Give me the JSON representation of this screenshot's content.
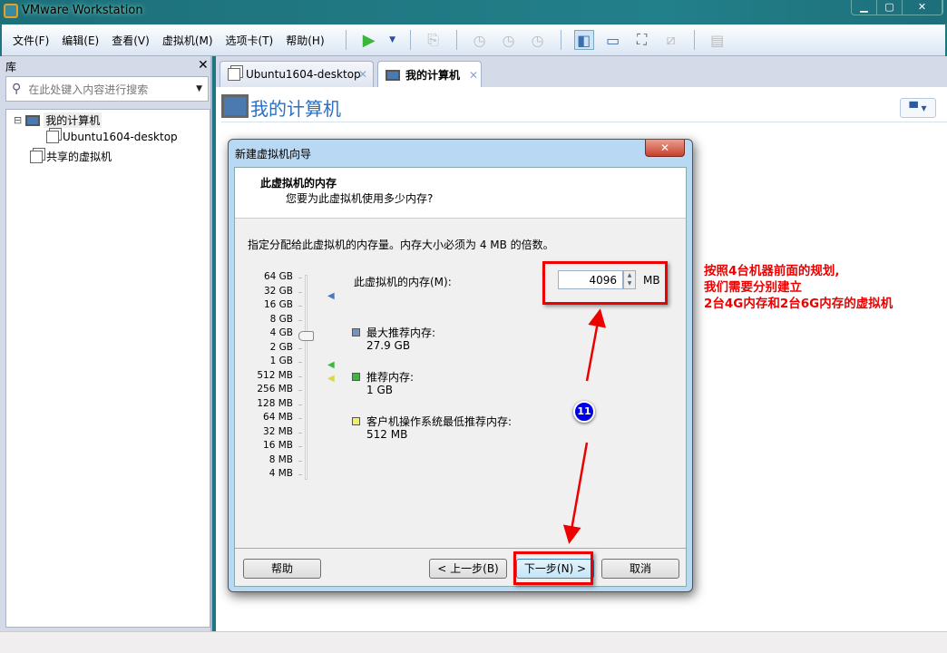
{
  "window": {
    "title": "VMware Workstation",
    "controls": [
      "▁",
      "▢",
      "✕"
    ]
  },
  "menu": [
    "文件(F)",
    "编辑(E)",
    "查看(V)",
    "虚拟机(M)",
    "选项卡(T)",
    "帮助(H)"
  ],
  "library": {
    "title": "库",
    "close": "✕",
    "search_placeholder": "在此处键入内容进行搜索",
    "tree": [
      {
        "label": "我的计算机",
        "expander": "⊟"
      },
      {
        "label": "Ubuntu1604-desktop"
      },
      {
        "label": "共享的虚拟机"
      }
    ]
  },
  "tabs": [
    {
      "label": "Ubuntu1604-desktop",
      "close": "✕"
    },
    {
      "label": "我的计算机",
      "close": "✕"
    }
  ],
  "main": {
    "title": "我的计算机"
  },
  "dialog": {
    "title": "新建虚拟机向导",
    "close": "✕",
    "heading": "此虚拟机的内存",
    "subheading": "您要为此虚拟机使用多少内存?",
    "instruction": "指定分配给此虚拟机的内存量。内存大小必须为 4 MB 的倍数。",
    "scale": [
      "64 GB",
      "32 GB",
      "16 GB",
      "8 GB",
      "4 GB",
      "2 GB",
      "1 GB",
      "512 MB",
      "256 MB",
      "128 MB",
      "64 MB",
      "32 MB",
      "16 MB",
      "8 MB",
      "4 MB"
    ],
    "slider_value": "4 GB",
    "memory_label": "此虚拟机的内存(M):",
    "memory_value": "4096",
    "memory_unit": "MB",
    "legend": [
      {
        "label": "最大推荐内存:",
        "value": "27.9 GB",
        "color": "#6f95c8"
      },
      {
        "label": "推荐内存:",
        "value": "1 GB",
        "color": "#3cb83c"
      },
      {
        "label": "客户机操作系统最低推荐内存:",
        "value": "512 MB",
        "color": "#f0f060"
      }
    ],
    "buttons": {
      "help": "帮助",
      "back": "< 上一步(B)",
      "next": "下一步(N) >",
      "cancel": "取消"
    }
  },
  "annotation": {
    "lines": [
      "按照4台机器前面的规划,",
      "我们需要分别建立",
      "2台4G内存和2台6G内存的虚拟机"
    ],
    "step": "11"
  }
}
